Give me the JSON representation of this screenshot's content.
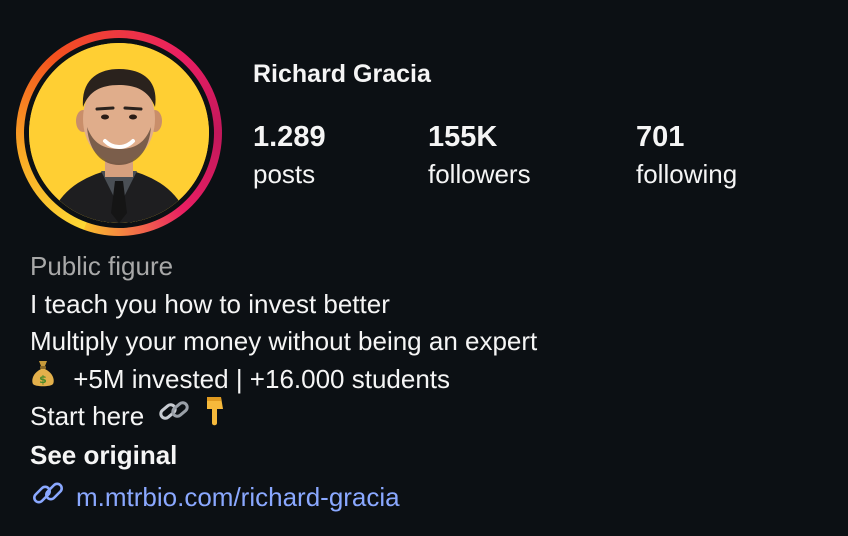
{
  "profile": {
    "username": "Richard Gracia",
    "avatar_ring_colors": [
      "#fdd835",
      "#f4511e",
      "#e91e63"
    ],
    "avatar_bg": "#ffcf33"
  },
  "stats": {
    "posts": {
      "value": "1.289",
      "label": "posts"
    },
    "followers": {
      "value": "155K",
      "label": "followers"
    },
    "following": {
      "value": "701",
      "label": "following"
    }
  },
  "bio": {
    "category": "Public figure",
    "line1": "I teach you how to invest better",
    "line2": "Multiply your money without being an expert",
    "line3_icon": "money-bag-icon",
    "line3": "+5M invested | +16.000 students",
    "line4": "Start here",
    "line4_icons": [
      "link-icon",
      "pointing-down-icon"
    ],
    "see_original": "See original",
    "link": "m.mtrbio.com/richard-gracia",
    "link_icon": "link-icon",
    "link_color": "#8aa8ff"
  }
}
